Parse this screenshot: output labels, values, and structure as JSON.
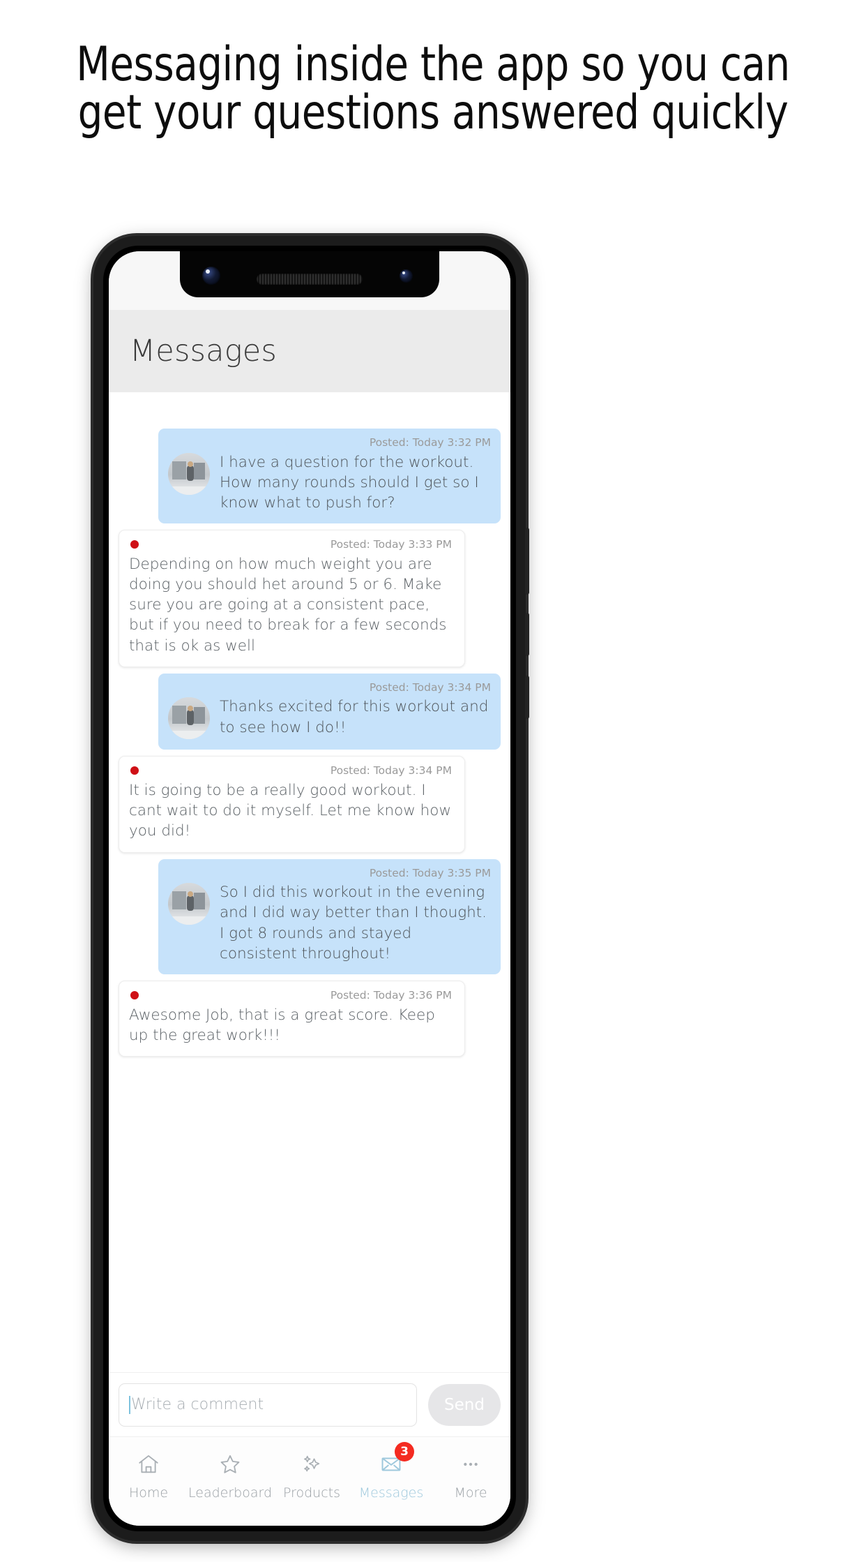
{
  "promo": {
    "heading": "Messaging inside the app so you can get your questions answered quickly"
  },
  "colors": {
    "bubble_incoming_blue": "#c6e2fa",
    "bubble_outgoing_white": "#ffffff",
    "unread_dot_red": "#cf1016",
    "badge_red": "#f42b21",
    "active_tab": "#9fc9dd",
    "header_bar": "#ebebeb"
  },
  "app": {
    "header": {
      "title": "Messages"
    },
    "messages": [
      {
        "side": "me",
        "style": "blue",
        "has_avatar": true,
        "has_unread_dot": false,
        "timestamp": "Posted: Today 3:32 PM",
        "text": "I have a question for the workout. How many rounds should I get so I know what to push for?"
      },
      {
        "side": "them",
        "style": "white",
        "has_avatar": false,
        "has_unread_dot": true,
        "timestamp": "Posted: Today 3:33 PM",
        "text": "Depending on how much weight you are doing you should het around 5 or 6.  Make sure you are going at a consistent pace, but if you need to break for a few seconds that is ok as well"
      },
      {
        "side": "me",
        "style": "blue",
        "has_avatar": true,
        "has_unread_dot": false,
        "timestamp": "Posted: Today 3:34 PM",
        "text": "Thanks excited for this workout and to see how I do!!"
      },
      {
        "side": "them",
        "style": "white",
        "has_avatar": false,
        "has_unread_dot": true,
        "timestamp": "Posted: Today 3:34 PM",
        "text": "It is going to be a really good workout.  I cant wait to do it myself.  Let me know how you did!"
      },
      {
        "side": "me",
        "style": "blue",
        "has_avatar": true,
        "has_unread_dot": false,
        "timestamp": "Posted: Today 3:35 PM",
        "text": "So I did this workout in the evening and I did way better than I thought. I got 8 rounds and stayed consistent throughout!"
      },
      {
        "side": "them",
        "style": "white",
        "has_avatar": false,
        "has_unread_dot": true,
        "timestamp": "Posted: Today 3:36 PM",
        "text": "Awesome Job, that is a great score.  Keep up the great work!!!"
      }
    ],
    "composer": {
      "placeholder": "Write a comment",
      "value": "",
      "send_label": "Send"
    },
    "bottom_nav": [
      {
        "label": "Home",
        "icon": "home-icon",
        "active": false,
        "badge": ""
      },
      {
        "label": "Leaderboard",
        "icon": "star-icon",
        "active": false,
        "badge": ""
      },
      {
        "label": "Products",
        "icon": "sparkles-icon",
        "active": false,
        "badge": ""
      },
      {
        "label": "Messages",
        "icon": "envelope-icon",
        "active": true,
        "badge": "3"
      },
      {
        "label": "More",
        "icon": "ellipsis-icon",
        "active": false,
        "badge": ""
      }
    ]
  }
}
